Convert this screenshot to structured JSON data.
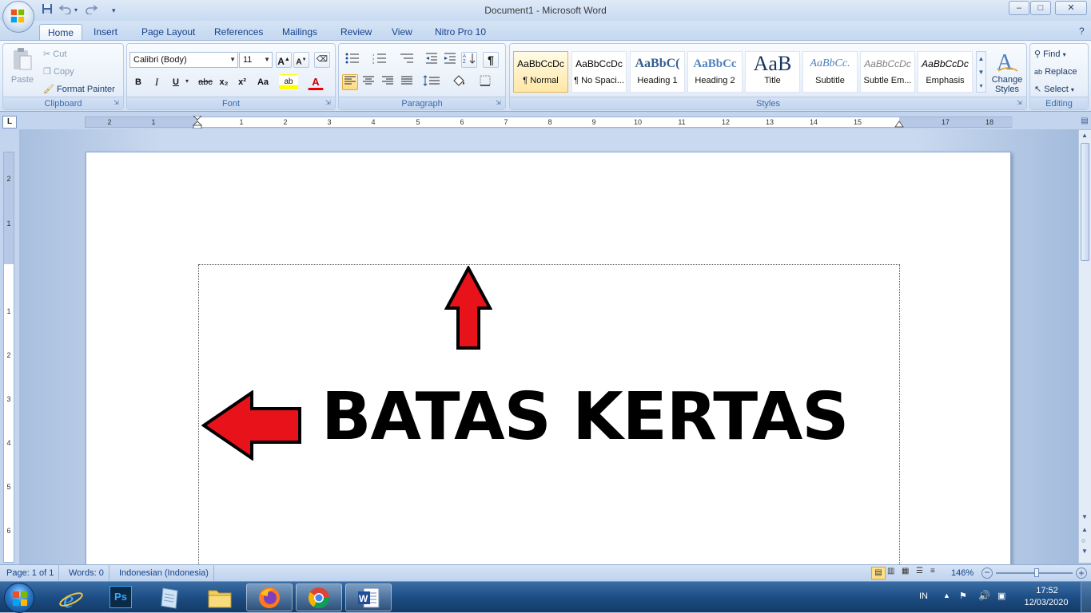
{
  "window": {
    "title": "Document1 - Microsoft Word",
    "minimize_glyph": "–",
    "maximize_glyph": "□",
    "close_glyph": "✕"
  },
  "quick_access": {
    "save_icon": "save-icon",
    "undo_icon": "undo-icon",
    "redo_icon": "redo-icon"
  },
  "tabs": [
    "Home",
    "Insert",
    "Page Layout",
    "References",
    "Mailings",
    "Review",
    "View",
    "Nitro Pro 10"
  ],
  "active_tab": "Home",
  "ribbon": {
    "clipboard": {
      "label": "Clipboard",
      "paste": "Paste",
      "cut": "Cut",
      "copy": "Copy",
      "format_painter": "Format Painter"
    },
    "font": {
      "label": "Font",
      "font_name": "Calibri (Body)",
      "font_size": "11",
      "grow": "A",
      "shrink": "A",
      "bold": "B",
      "italic": "I",
      "underline": "U",
      "strike": "abc",
      "subscript": "x₂",
      "superscript": "x²",
      "change_case": "Aa",
      "highlight": "ab",
      "font_color": "A"
    },
    "paragraph": {
      "label": "Paragraph",
      "pilcrow": "¶"
    },
    "styles": {
      "label": "Styles",
      "items": [
        {
          "sample": "AaBbCcDc",
          "name": "¶ Normal"
        },
        {
          "sample": "AaBbCcDc",
          "name": "¶ No Spaci..."
        },
        {
          "sample": "AaBbC(",
          "name": "Heading 1"
        },
        {
          "sample": "AaBbCc",
          "name": "Heading 2"
        },
        {
          "sample": "AaB",
          "name": "Title"
        },
        {
          "sample": "AaBbCc.",
          "name": "Subtitle"
        },
        {
          "sample": "AaBbCcDc",
          "name": "Subtle Em..."
        },
        {
          "sample": "AaBbCcDc",
          "name": "Emphasis"
        }
      ],
      "change_styles_1": "Change",
      "change_styles_2": "Styles"
    },
    "editing": {
      "label": "Editing",
      "find": "Find",
      "replace": "Replace",
      "select": "Select"
    }
  },
  "ruler": {
    "tab_selector": "L",
    "h_numbers": [
      "2",
      "1",
      "1",
      "2",
      "3",
      "4",
      "5",
      "6",
      "7",
      "8",
      "9",
      "10",
      "11",
      "12",
      "13",
      "14",
      "15",
      "17",
      "18"
    ],
    "v_numbers": [
      "2",
      "1",
      "1",
      "2",
      "3",
      "4",
      "5",
      "6"
    ]
  },
  "document": {
    "headline": "BATAS KERTAS",
    "arrow_color": "#e8121b"
  },
  "statusbar": {
    "page": "Page: 1 of 1",
    "words": "Words: 0",
    "language": "Indonesian (Indonesia)",
    "zoom": "146%"
  },
  "taskbar": {
    "apps": [
      "ie-icon",
      "photoshop-icon",
      "notepad-icon",
      "explorer-icon",
      "firefox-icon",
      "chrome-icon",
      "word-icon"
    ],
    "ps_label": "Ps",
    "lang": "IN",
    "time": "17:52",
    "date": "12/03/2020"
  }
}
